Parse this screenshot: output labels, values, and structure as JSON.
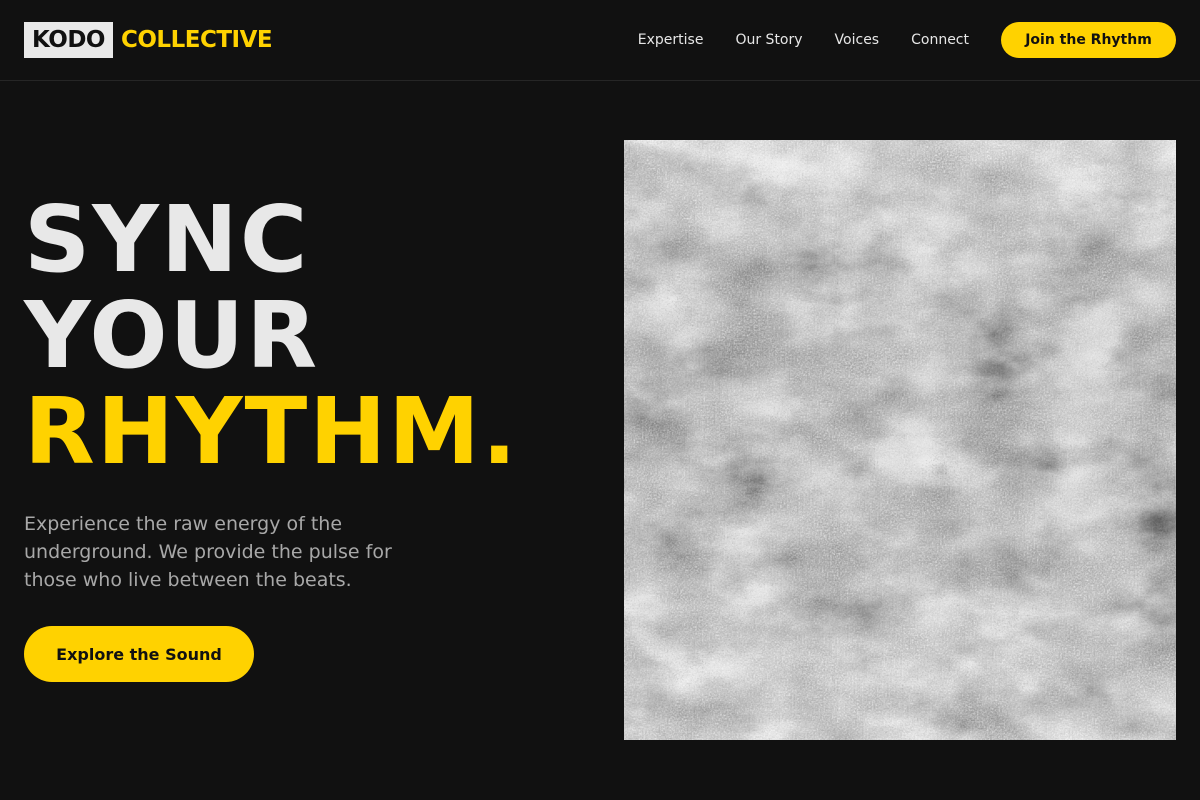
{
  "header": {
    "logo_box": "KODO",
    "logo_text": "COLLECTIVE",
    "nav": [
      {
        "label": "Expertise"
      },
      {
        "label": "Our Story"
      },
      {
        "label": "Voices"
      },
      {
        "label": "Connect"
      }
    ],
    "cta_label": "Join the Rhythm"
  },
  "hero": {
    "title_lines": [
      "SYNC",
      "YOUR",
      "RHYTHM."
    ],
    "description": "Experience the raw energy of the underground. We provide the pulse for those who live between the beats.",
    "cta_label": "Explore the Sound",
    "image_subject": "grunge-concrete-texture"
  },
  "colors": {
    "background": "#111111",
    "accent": "#ffd200",
    "heading": "#e8e8e8",
    "body_text": "#a8a8a8"
  }
}
